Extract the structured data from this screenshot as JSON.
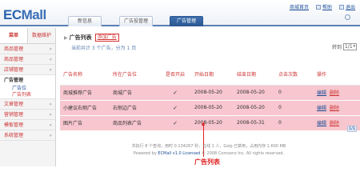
{
  "header": {
    "logo_prefix": "EC",
    "logo_suffix": "Mall",
    "tabs": [
      {
        "label": "新信息",
        "active": false
      },
      {
        "label": "广告投管理",
        "active": false
      },
      {
        "label": "广告管理",
        "active": true
      }
    ],
    "top_links": [
      {
        "label": "商城首页"
      },
      {
        "label": "帮助"
      },
      {
        "label": "退出"
      }
    ]
  },
  "sidebar": {
    "tabs": [
      "菜单",
      "数据维护"
    ],
    "items": [
      {
        "label": "商品管理",
        "open": false
      },
      {
        "label": "商品管理",
        "open": false
      },
      {
        "label": "店铺管理",
        "open": false
      },
      {
        "label": "广告管理",
        "open": true,
        "children": [
          "广告位",
          "广告列表"
        ],
        "current_child": 1
      },
      {
        "label": "文章管理",
        "open": false
      },
      {
        "label": "营销管理",
        "open": false
      },
      {
        "label": "模板管理",
        "open": false
      },
      {
        "label": "系统管理",
        "open": false
      }
    ]
  },
  "content": {
    "breadcrumb_title": "广告列表",
    "add_link": "添加广告",
    "summary": "当前共计 3 个广告，分为 1 页",
    "pager_label": "转到",
    "pager_value": "1/1",
    "columns": [
      "广告名称",
      "所在广告位",
      "是否开启",
      "开始日期",
      "结束日期",
      "点击次数",
      "操作"
    ],
    "rows": [
      {
        "name": "商城推荐广告",
        "position": "商城广告",
        "enabled": "✓",
        "start": "2008-05-20",
        "end": "2008-05-20",
        "clicks": "0",
        "ops": [
          "编辑",
          "删除"
        ]
      },
      {
        "name": "小建议右侧广告",
        "position": "右侧边广告",
        "enabled": "✓",
        "start": "2008-05-20",
        "end": "2008-05-20",
        "clicks": "0",
        "ops": [
          "编辑",
          "删除"
        ]
      },
      {
        "name": "图片广告",
        "position": "商品列表广告",
        "enabled": "✓",
        "start": "2008-05-20",
        "end": "2008-05-31",
        "clicks": "0",
        "ops": [
          "编辑",
          "删除"
        ]
      }
    ],
    "annotation": "广告列表",
    "pager_bottom": "1/1"
  },
  "footer": {
    "line1": "共执行 8 个查询，用时 0.134267 秒，在线 1 人，Gzip 已禁用，占用内存 1.600 MB",
    "line2_prefix": "Powered by ",
    "line2_link": "ECMall v1.0 Licensed",
    "line2_suffix": " © 2008 Comsenz Inc. All rights reserved."
  }
}
